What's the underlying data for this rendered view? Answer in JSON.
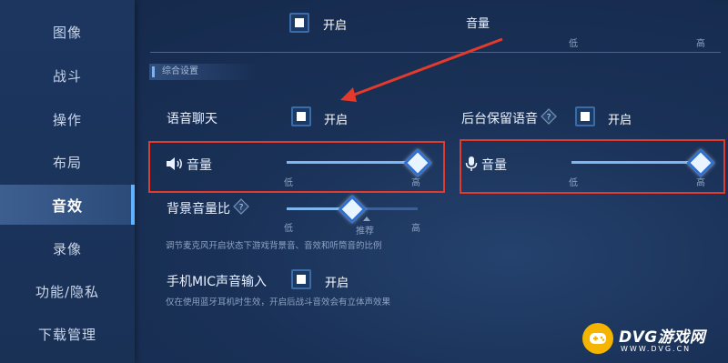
{
  "sidebar": {
    "items": [
      {
        "label": "图像"
      },
      {
        "label": "战斗"
      },
      {
        "label": "操作"
      },
      {
        "label": "布局"
      },
      {
        "label": "音效",
        "active": true
      },
      {
        "label": "录像"
      },
      {
        "label": "功能/隐私"
      },
      {
        "label": "下载管理"
      }
    ]
  },
  "top_strip": {
    "left_value": "开启",
    "right_label": "音量",
    "low": "低",
    "high": "高"
  },
  "section": {
    "title": "综合设置"
  },
  "voice_chat": {
    "label": "语音聊天",
    "state": "开启",
    "checked": true
  },
  "background_voice": {
    "label": "后台保留语音",
    "state": "开启",
    "checked": true
  },
  "speaker_volume": {
    "label": "音量",
    "low": "低",
    "high": "高",
    "level": 1.0,
    "icon": "speaker-icon"
  },
  "mic_volume": {
    "label": "音量",
    "low": "低",
    "high": "高",
    "level": 1.0,
    "icon": "microphone-icon"
  },
  "bg_ratio": {
    "label": "背景音量比",
    "low": "低",
    "recommended": "推荐",
    "high": "高",
    "level": 0.5,
    "hint": "调节麦克风开启状态下游戏背景音、音效和听筒音的比例"
  },
  "phone_mic": {
    "label": "手机MIC声音输入",
    "state": "开启",
    "checked": true,
    "hint": "仅在使用蓝牙耳机时生效，开启后战斗音效会有立体声效果"
  },
  "watermark": {
    "brand": "DVG游戏网",
    "url": "WWW.DVG.CN"
  },
  "colors": {
    "highlight_box": "#e23a2c",
    "accent": "#2e6fd0",
    "track": "#3d5f94"
  }
}
